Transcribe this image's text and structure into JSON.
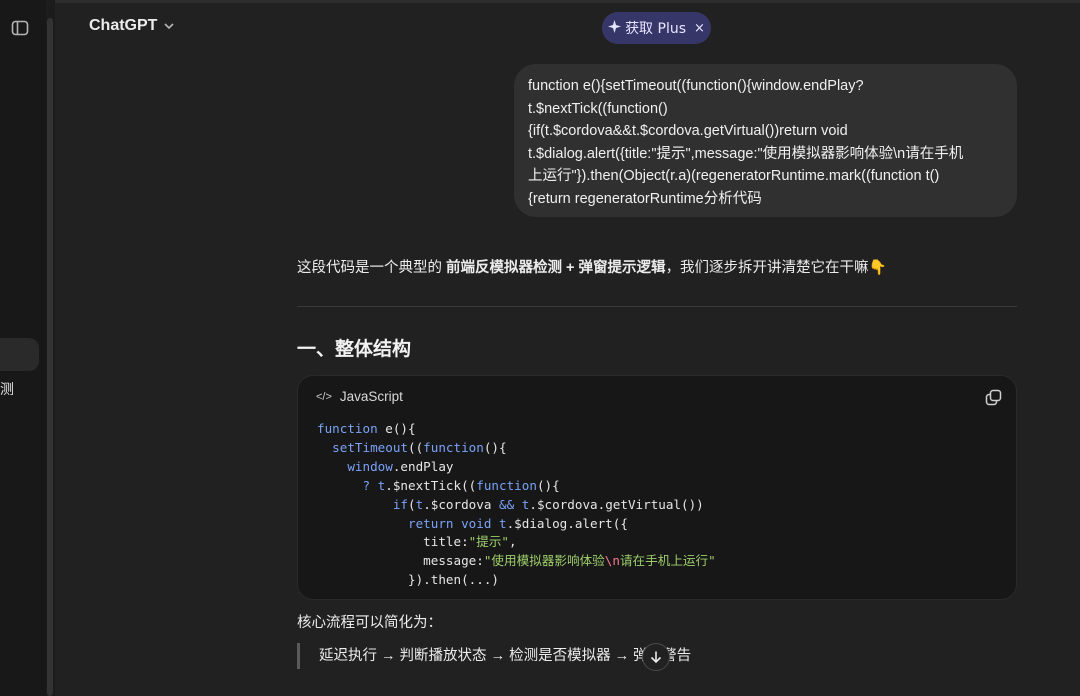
{
  "header": {
    "model_name": "ChatGPT",
    "plus_label": "获取 Plus",
    "plus_close": "×"
  },
  "sidebar": {
    "clipped_item_char": "测"
  },
  "user_message": {
    "lines": [
      "function e(){setTimeout((function(){window.endPlay?",
      "t.$nextTick((function()",
      "{if(t.$cordova&&t.$cordova.getVirtual())return void",
      "t.$dialog.alert({title:\"提示\",message:\"使用模拟器影响体验\\n请在手机",
      "上运行\"}).then(Object(r.a)(regeneratorRuntime.mark((function t()",
      "{return regeneratorRuntime分析代码"
    ]
  },
  "answer": {
    "intro_prefix": "这段代码是一个典型的 ",
    "intro_bold": "前端反模拟器检测 + 弹窗提示逻辑",
    "intro_suffix": "，我们逐步拆开讲清楚它在干嘛👇",
    "section_title": "一、整体结构",
    "code_language": "JavaScript",
    "code_language_icon": "</>",
    "code": {
      "l1_kw": "function",
      "l1_rest": " e(){",
      "l2_fn": "setTimeout",
      "l2_mid": "((",
      "l2_kw": "function",
      "l2_rest": "(){",
      "l3_kw": "window",
      "l3_rest": ".endPlay",
      "l4_q": "? ",
      "l4_t": "t",
      "l4_rest": ".$nextTick((",
      "l4_kw": "function",
      "l4_end": "(){",
      "l5_kw": "if",
      "l5_open": "(",
      "l5_t1": "t",
      "l5_mid": ".$cordova ",
      "l5_and": "&&",
      "l5_sp": " ",
      "l5_t2": "t",
      "l5_rest": ".$cordova.getVirtual())",
      "l6_kw": "return void",
      "l6_sp": " ",
      "l6_t": "t",
      "l6_rest": ".$dialog.alert({",
      "l7_key": "title:",
      "l7_str": "\"提示\"",
      "l7_end": ",",
      "l8_key": "message:",
      "l8_str1": "\"使用模拟器影响体验",
      "l8_esc": "\\n",
      "l8_str2": "请在手机上运行\"",
      "l9": "}).then(...)"
    },
    "flow_intro": "核心流程可以简化为：",
    "flow_quote": "延迟执行 → 判断播放状态 → 检测是否模拟器 → 弹窗警告"
  },
  "icons": {
    "sidebar_toggle": "sidebar-toggle-icon",
    "chevron": "chevron-down-icon",
    "sparkle": "sparkle-icon",
    "copy": "copy-icon",
    "arrow_down": "arrow-down-icon"
  }
}
